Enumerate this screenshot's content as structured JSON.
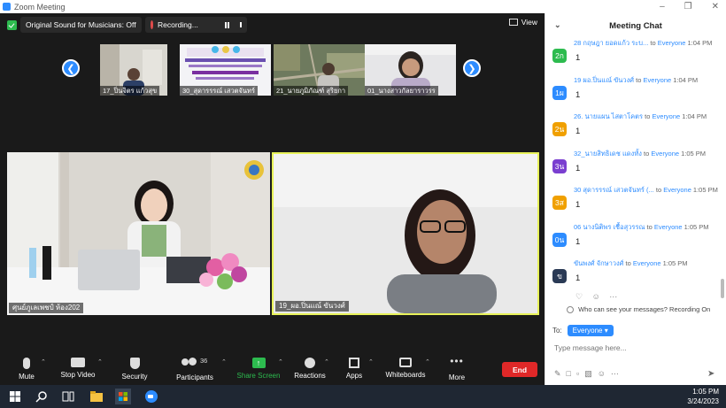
{
  "window": {
    "title": "Zoom Meeting",
    "minimize": "–",
    "maximize": "❐",
    "close": "✕"
  },
  "topbar": {
    "original_sound": "Original Sound for Musicians: Off",
    "recording": "Recording...",
    "view": "View"
  },
  "thumbnails": [
    {
      "name": "17_ปิ่นจิตร แก้วสุข"
    },
    {
      "name": "30_สุดารรรณ์ เสวตจันทร์"
    },
    {
      "name": "21_นายภูมิภัณฑ์ สุริยกา"
    },
    {
      "name": "01_นางสาวกัลยาราวรร"
    }
  ],
  "videos": [
    {
      "name": "ศุนย์ภูเลเพชป์ ห้อง202"
    },
    {
      "name": "19_ผอ.ปิ่นแณ์ ขันวงศ์"
    }
  ],
  "toolbar": {
    "mute": "Mute",
    "stop_video": "Stop Video",
    "security": "Security",
    "participants": "Participants",
    "participants_count": "36",
    "share_screen": "Share Screen",
    "reactions": "Reactions",
    "apps": "Apps",
    "whiteboards": "Whiteboards",
    "more": "More",
    "end": "End"
  },
  "chat": {
    "title": "Meeting Chat",
    "messages": [
      {
        "sender": "28 กฤษฎา ยอดแก้ว ระบ...",
        "to": "to",
        "recipient": "Everyone",
        "time": "1:04 PM",
        "avatar": "2ก",
        "avatar_color": "#2dbb4f",
        "text": "1"
      },
      {
        "sender": "19 ผอ.ปิ่นแณ์ ขันวงศ์",
        "to": "to",
        "recipient": "Everyone",
        "time": "1:04 PM",
        "avatar": "1ผ",
        "avatar_color": "#2d8cff",
        "text": "1"
      },
      {
        "sender": "26. นายแผน ไสตาโคตร",
        "to": "to",
        "recipient": "Everyone",
        "time": "1:04 PM",
        "avatar": "2น",
        "avatar_color": "#f0a000",
        "text": "1"
      },
      {
        "sender": "32_นายสิทธิเดช แดงทั้ง",
        "to": "to",
        "recipient": "Everyone",
        "time": "1:05 PM",
        "avatar": "3น",
        "avatar_color": "#7a3fd0",
        "text": "1"
      },
      {
        "sender": "30 สุดารรรณ์ เสวตจันทร์ (...",
        "to": "to",
        "recipient": "Everyone",
        "time": "1:05 PM",
        "avatar": "3ส",
        "avatar_color": "#f0a000",
        "text": "1"
      },
      {
        "sender": "06 นางนิติพร เชื้อสุวรรณ",
        "to": "to",
        "recipient": "Everyone",
        "time": "1:05 PM",
        "avatar": "0น",
        "avatar_color": "#2d8cff",
        "text": "1"
      },
      {
        "sender": "ขันพงศ์ จักษาวงศ์",
        "to": "to",
        "recipient": "Everyone",
        "time": "1:05 PM",
        "avatar": "ข",
        "avatar_color": "#2a3a55",
        "text": "1"
      }
    ],
    "who_can_see": "Who can see your messages? Recording On",
    "to_label": "To:",
    "recipient": "Everyone",
    "input_placeholder": "Type message here..."
  },
  "taskbar": {
    "time": "1:05 PM",
    "date": "3/24/2023"
  }
}
